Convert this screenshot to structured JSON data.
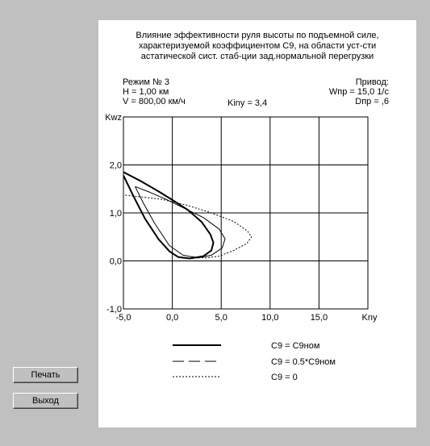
{
  "title_lines": [
    "Влияние эффективности руля высоты по подъемной силе,",
    "характеризуемой коэффициентом C9, на области уст-сти",
    "астатической сист. стаб-ции зад.нормальной перегрузки"
  ],
  "info_left": [
    "Режим № 3",
    "H = 1,00 км",
    "V = 800,00 км/ч"
  ],
  "info_mid": "Kiny = 3,4",
  "info_right": [
    "Привод:",
    "Wпр = 15,0  1/с",
    "Dпр = ,6"
  ],
  "buttons": {
    "print": "Печать",
    "exit": "Выход"
  },
  "chart_data": {
    "type": "line",
    "xlabel": "Kny",
    "ylabel": "Kwz",
    "xlim": [
      -5,
      20
    ],
    "ylim": [
      -1,
      3
    ],
    "x_ticks": [
      "-5,0",
      "0,0",
      "5,0",
      "10,0",
      "15,0"
    ],
    "y_ticks": [
      "-1,0",
      "0,0",
      "1,0",
      "2,0"
    ],
    "grid": true,
    "series": [
      {
        "name": "C9 =  C9ном",
        "style": "solid-thick",
        "points": [
          [
            -5.0,
            1.85
          ],
          [
            -3.2,
            1.66
          ],
          [
            -1.5,
            1.46
          ],
          [
            0.0,
            1.27
          ],
          [
            1.6,
            1.06
          ],
          [
            3.0,
            0.81
          ],
          [
            3.9,
            0.55
          ],
          [
            4.2,
            0.38
          ],
          [
            4.0,
            0.22
          ],
          [
            3.2,
            0.1
          ],
          [
            1.8,
            0.05
          ],
          [
            0.6,
            0.08
          ],
          [
            -0.3,
            0.2
          ],
          [
            -1.4,
            0.45
          ],
          [
            -2.8,
            0.88
          ],
          [
            -4.0,
            1.36
          ],
          [
            -5.0,
            1.78
          ]
        ]
      },
      {
        "name": "C9 =  0.5*C9ном",
        "style": "solid-thin",
        "points": [
          [
            -3.8,
            1.55
          ],
          [
            -2.3,
            1.43
          ],
          [
            -0.6,
            1.28
          ],
          [
            1.2,
            1.1
          ],
          [
            3.2,
            0.9
          ],
          [
            4.8,
            0.66
          ],
          [
            5.4,
            0.46
          ],
          [
            5.1,
            0.27
          ],
          [
            4.0,
            0.12
          ],
          [
            2.6,
            0.06
          ],
          [
            1.1,
            0.12
          ],
          [
            -0.3,
            0.32
          ],
          [
            -1.8,
            0.78
          ],
          [
            -3.0,
            1.22
          ],
          [
            -3.8,
            1.55
          ]
        ]
      },
      {
        "name": "C9 = 0",
        "style": "dotted",
        "points": [
          [
            -4.8,
            1.37
          ],
          [
            -3.0,
            1.33
          ],
          [
            -1.0,
            1.28
          ],
          [
            1.5,
            1.16
          ],
          [
            4.0,
            1.0
          ],
          [
            6.3,
            0.82
          ],
          [
            7.7,
            0.62
          ],
          [
            8.1,
            0.5
          ],
          [
            7.6,
            0.36
          ],
          [
            6.3,
            0.22
          ],
          [
            4.8,
            0.1
          ],
          [
            3.3,
            0.06
          ],
          [
            2.1,
            0.09
          ]
        ]
      }
    ]
  }
}
